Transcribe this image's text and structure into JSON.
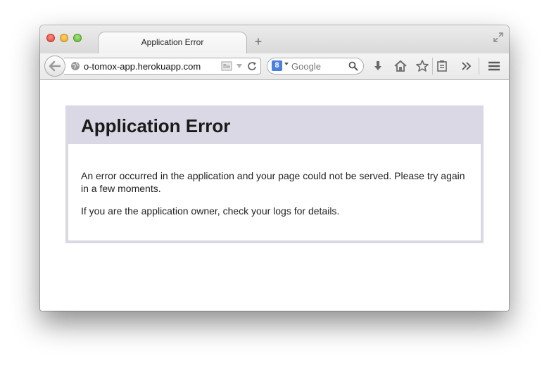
{
  "window": {
    "tab_title": "Application Error",
    "new_tab": "+"
  },
  "navbar": {
    "url": "o-tomox-app.herokuapp.com",
    "search_placeholder": "Google",
    "search_engine_letter": "8"
  },
  "page": {
    "heading": "Application Error",
    "message": "An error occurred in the application and your page could not be served. Please try again in a few moments.",
    "owner_note": "If you are the application owner, check your logs for details."
  },
  "colors": {
    "error_header_bg": "#dad8e4",
    "close": "#e0443a",
    "minimize": "#e5a52a",
    "maximize": "#5fb43b"
  },
  "icons": [
    "back-arrow-icon",
    "globe-icon",
    "reader-icon",
    "dropdown-icon",
    "reload-icon",
    "google-icon",
    "search-icon",
    "download-icon",
    "home-icon",
    "bookmark-star-icon",
    "bookmarks-list-icon",
    "overflow-chevron-icon",
    "menu-icon",
    "fullscreen-icon"
  ]
}
